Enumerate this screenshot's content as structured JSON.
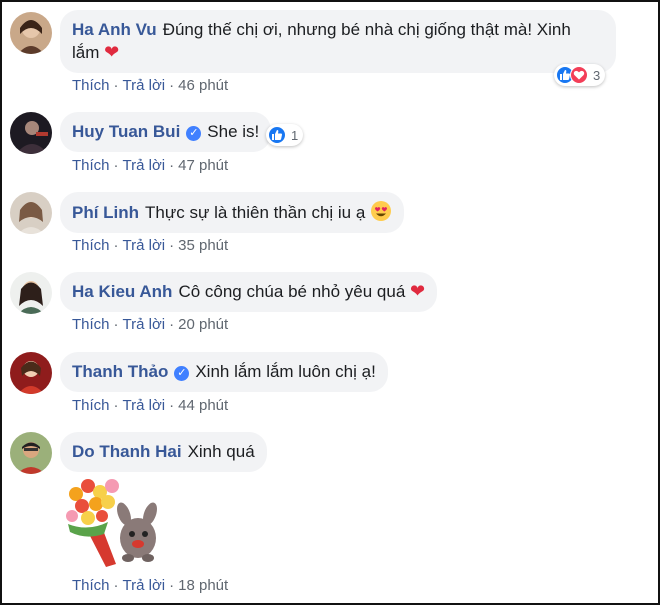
{
  "comments": [
    {
      "author": "Ha Anh Vu",
      "verified": false,
      "text_line1": "Đúng thế chị ơi, nhưng bé nhà chị giống thật mà! Xinh",
      "text_line2": "lắm",
      "trailing_emoji": "heart",
      "like_label": "Thích",
      "reply_label": "Trả lời",
      "time": "46 phút",
      "reactions": {
        "icons": [
          "like-icon",
          "love-icon"
        ],
        "count": "3"
      }
    },
    {
      "author": "Huy Tuan Bui",
      "verified": true,
      "text": "She is!",
      "like_label": "Thích",
      "reply_label": "Trả lời",
      "time": "47 phút",
      "reactions": {
        "icons": [
          "like-icon"
        ],
        "count": "1"
      }
    },
    {
      "author": "Phí Linh",
      "verified": false,
      "text": "Thực sự là thiên thần chị iu ạ",
      "trailing_emoji": "heart-eyes-face",
      "like_label": "Thích",
      "reply_label": "Trả lời",
      "time": "35 phút"
    },
    {
      "author": "Ha Kieu Anh",
      "verified": false,
      "text": "Cô công chúa bé nhỏ yêu quá",
      "trailing_emoji": "heart",
      "like_label": "Thích",
      "reply_label": "Trả lời",
      "time": "20 phút"
    },
    {
      "author": "Thanh Thảo",
      "verified": true,
      "text": "Xinh lắm lắm luôn chị ạ!",
      "like_label": "Thích",
      "reply_label": "Trả lời",
      "time": "44 phút"
    },
    {
      "author": "Do Thanh Hai",
      "verified": false,
      "text": "Xinh quá",
      "sticker": "flower-bouquet-bunny-sticker",
      "like_label": "Thích",
      "reply_label": "Trả lời",
      "time": "18 phút"
    }
  ],
  "symbols": {
    "separator": "·",
    "heart": "❤"
  },
  "colors": {
    "author_link": "#385898",
    "bubble_bg": "#f2f3f5",
    "meta_text": "#606770",
    "like_blue": "#1877f2",
    "love_red": "#f33e58",
    "heart_red": "#e02a3f"
  }
}
